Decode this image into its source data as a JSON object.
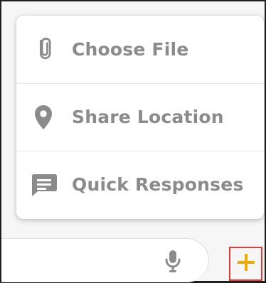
{
  "menu": {
    "items": [
      {
        "label": "Choose File",
        "icon": "paperclip-icon"
      },
      {
        "label": "Share Location",
        "icon": "location-pin-icon"
      },
      {
        "label": "Quick Responses",
        "icon": "message-icon"
      }
    ]
  },
  "composer": {
    "mic_icon": "microphone-icon"
  },
  "action": {
    "plus_icon": "plus-icon",
    "accent_color": "#f2a900",
    "highlight_color": "#e53935"
  },
  "colors": {
    "icon_gray": "#8b8b8b",
    "label_gray": "#8b8b8b"
  }
}
